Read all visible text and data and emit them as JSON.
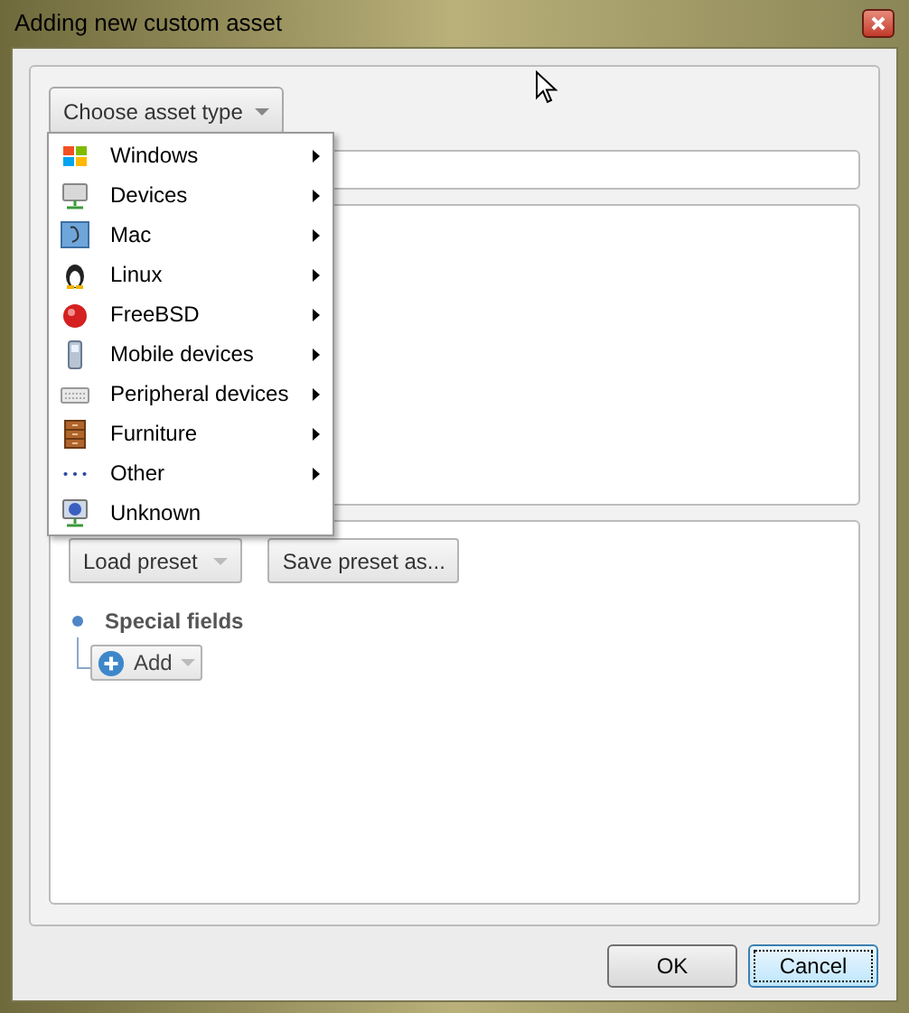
{
  "window": {
    "title": "Adding new custom asset"
  },
  "asset_type_button": {
    "label": "Choose asset type"
  },
  "asset_type_menu": [
    {
      "label": "Windows",
      "has_submenu": true
    },
    {
      "label": "Devices",
      "has_submenu": true
    },
    {
      "label": "Mac",
      "has_submenu": true
    },
    {
      "label": "Linux",
      "has_submenu": true
    },
    {
      "label": "FreeBSD",
      "has_submenu": true
    },
    {
      "label": "Mobile devices",
      "has_submenu": true
    },
    {
      "label": "Peripheral devices",
      "has_submenu": true
    },
    {
      "label": "Furniture",
      "has_submenu": true
    },
    {
      "label": "Other",
      "has_submenu": true
    },
    {
      "label": "Unknown",
      "has_submenu": false
    }
  ],
  "preset_buttons": [
    {
      "label": "Load preset",
      "dropdown": true
    },
    {
      "label": "Save preset as...",
      "dropdown": false
    }
  ],
  "special_fields": {
    "label": "Special fields",
    "add_button": "Add"
  },
  "dialog_buttons": [
    {
      "label": "OK",
      "focused": false
    },
    {
      "label": "Cancel",
      "focused": true
    }
  ]
}
